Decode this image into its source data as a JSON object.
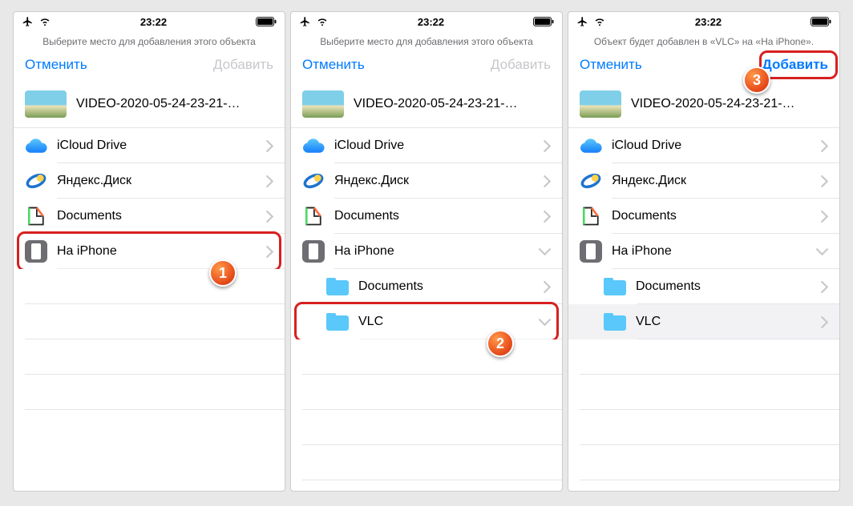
{
  "status": {
    "time": "23:22"
  },
  "screens": [
    {
      "instruction": "Выберите место для добавления этого объекта",
      "cancel": "Отменить",
      "add": "Добавить",
      "add_enabled": false,
      "file": "VIDEO-2020-05-24-23-21-…",
      "items": [
        {
          "kind": "icloud",
          "label": "iCloud Drive",
          "chev": "right",
          "indent": 0
        },
        {
          "kind": "yandex",
          "label": "Яндекс.Диск",
          "chev": "right",
          "indent": 0
        },
        {
          "kind": "documents",
          "label": "Documents",
          "chev": "right",
          "indent": 0
        },
        {
          "kind": "iphone",
          "label": "На iPhone",
          "chev": "right",
          "indent": 0,
          "highlight": true,
          "step": "1"
        }
      ]
    },
    {
      "instruction": "Выберите место для добавления этого объекта",
      "cancel": "Отменить",
      "add": "Добавить",
      "add_enabled": false,
      "file": "VIDEO-2020-05-24-23-21-…",
      "items": [
        {
          "kind": "icloud",
          "label": "iCloud Drive",
          "chev": "right",
          "indent": 0
        },
        {
          "kind": "yandex",
          "label": "Яндекс.Диск",
          "chev": "right",
          "indent": 0
        },
        {
          "kind": "documents",
          "label": "Documents",
          "chev": "right",
          "indent": 0
        },
        {
          "kind": "iphone",
          "label": "На iPhone",
          "chev": "down",
          "indent": 0
        },
        {
          "kind": "folder",
          "label": "Documents",
          "chev": "right",
          "indent": 1
        },
        {
          "kind": "folder",
          "label": "VLC",
          "chev": "down",
          "indent": 1,
          "highlight": true,
          "step": "2"
        }
      ]
    },
    {
      "instruction": "Объект будет добавлен в «VLC» на «На iPhone».",
      "cancel": "Отменить",
      "add": "Добавить",
      "add_enabled": true,
      "add_highlight": true,
      "step": "3",
      "file": "VIDEO-2020-05-24-23-21-…",
      "items": [
        {
          "kind": "icloud",
          "label": "iCloud Drive",
          "chev": "right",
          "indent": 0
        },
        {
          "kind": "yandex",
          "label": "Яндекс.Диск",
          "chev": "right",
          "indent": 0
        },
        {
          "kind": "documents",
          "label": "Documents",
          "chev": "right",
          "indent": 0
        },
        {
          "kind": "iphone",
          "label": "На iPhone",
          "chev": "down",
          "indent": 0
        },
        {
          "kind": "folder",
          "label": "Documents",
          "chev": "right",
          "indent": 1
        },
        {
          "kind": "folder",
          "label": "VLC",
          "chev": "right",
          "indent": 1,
          "selected": true
        }
      ]
    }
  ]
}
